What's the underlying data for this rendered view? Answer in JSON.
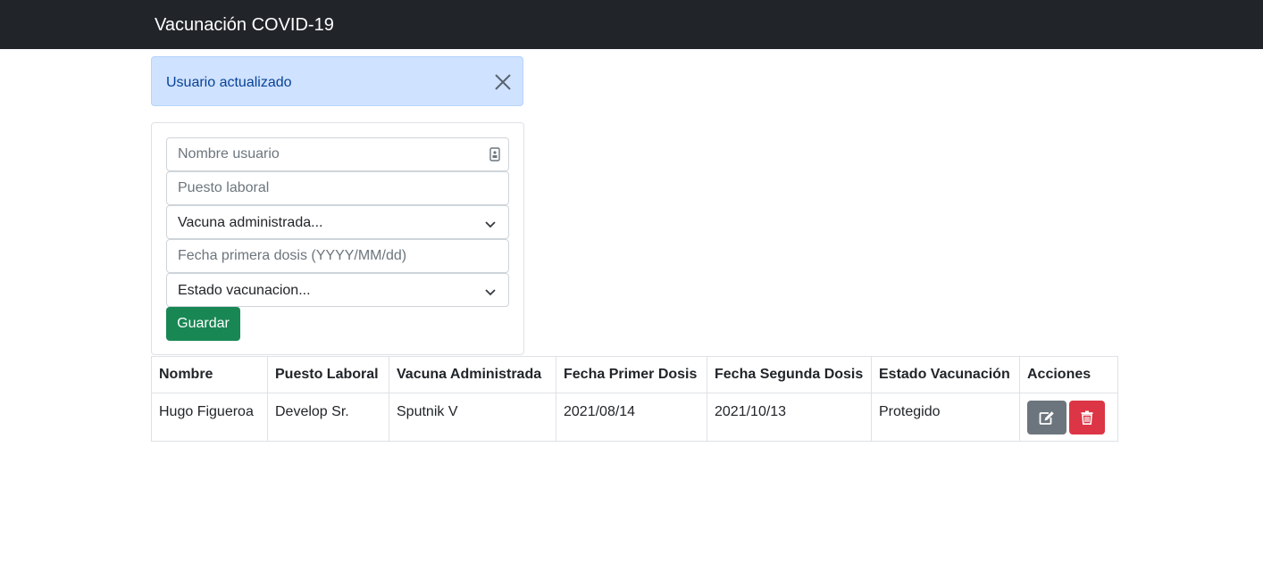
{
  "navbar": {
    "brand": "Vacunación COVID-19"
  },
  "alert": {
    "message": "Usuario actualizado",
    "close_icon": "close-icon"
  },
  "form": {
    "nombre": {
      "placeholder": "Nombre usuario",
      "value": ""
    },
    "puesto": {
      "placeholder": "Puesto laboral",
      "value": ""
    },
    "vacuna": {
      "selected": "Vacuna administrada..."
    },
    "fecha": {
      "placeholder": "Fecha primera dosis (YYYY/MM/dd)",
      "value": ""
    },
    "estado": {
      "selected": "Estado vacunacion..."
    },
    "save_label": "Guardar"
  },
  "table": {
    "headers": [
      "Nombre",
      "Puesto Laboral",
      "Vacuna Administrada",
      "Fecha Primer Dosis",
      "Fecha Segunda Dosis",
      "Estado Vacunación",
      "Acciones"
    ],
    "rows": [
      {
        "nombre": "Hugo Figueroa",
        "puesto": "Develop Sr.",
        "vacuna": "Sputnik V",
        "fecha1": "2021/08/14",
        "fecha2": "2021/10/13",
        "estado": "Protegido",
        "actions": {
          "edit_icon": "edit-icon",
          "delete_icon": "trash-icon"
        }
      }
    ]
  },
  "colors": {
    "navbar": "#212529",
    "alert_bg": "#cfe2ff",
    "alert_text": "#084298",
    "save_button": "#198754",
    "edit_button": "#6c757d",
    "delete_button": "#dc3545"
  }
}
